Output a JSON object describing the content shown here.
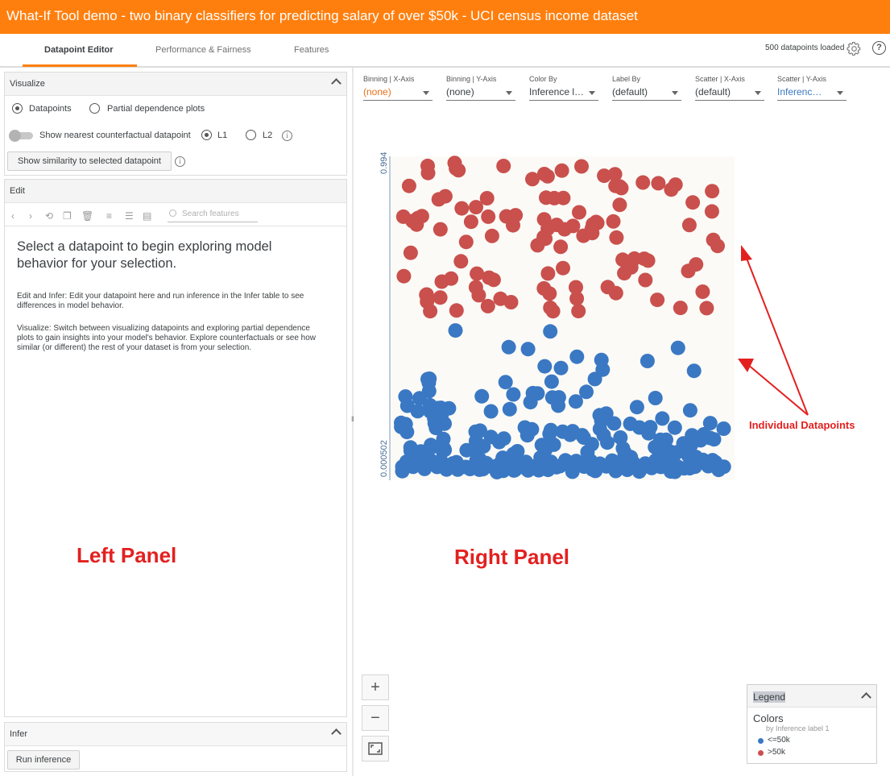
{
  "title": "What-If Tool demo - two binary classifiers for predicting salary of over $50k - UCI census income dataset",
  "tabs": {
    "datapoint_editor": "Datapoint Editor",
    "performance": "Performance & Fairness",
    "features": "Features"
  },
  "header": {
    "loaded": "500 datapoints loaded",
    "help": "?"
  },
  "visualize": {
    "title": "Visualize",
    "datapoints": "Datapoints",
    "pdp": "Partial dependence plots",
    "counterfactual": "Show nearest counterfactual datapoint",
    "l1": "L1",
    "l2": "L2",
    "similarity_button": "Show similarity to selected datapoint",
    "info": "i"
  },
  "edit": {
    "title": "Edit",
    "search_placeholder": "Search features",
    "heading": "Select a datapoint to begin exploring model behavior for your selection.",
    "para1": "Edit and Infer: Edit your datapoint here and run inference in the Infer table to see differences in model behavior.",
    "para2": "Visualize: Switch between visualizing datapoints and exploring partial dependence plots to gain insights into your model's behavior. Explore counterfactuals or see how similar (or different) the rest of your dataset is from your selection."
  },
  "infer": {
    "title": "Infer",
    "run_button": "Run inference"
  },
  "controls": {
    "binning_x": {
      "label": "Binning | X-Axis",
      "value": "(none)"
    },
    "binning_y": {
      "label": "Binning | Y-Axis",
      "value": "(none)"
    },
    "color_by": {
      "label": "Color By",
      "value": "Inference label"
    },
    "label_by": {
      "label": "Label By",
      "value": "(default)"
    },
    "scatter_x": {
      "label": "Scatter | X-Axis",
      "value": "(default)"
    },
    "scatter_y": {
      "label": "Scatter | Y-Axis",
      "value": "Inference score"
    }
  },
  "colors": {
    "accent": "#ff7f0e",
    "low": "#3a78c3",
    "high": "#c9504d"
  },
  "chart_data": {
    "type": "scatter",
    "ylim": [
      0.000502,
      0.994
    ],
    "ytick_labels": [
      "0.994",
      "0.000502"
    ],
    "series": [
      {
        "name": "<=50k",
        "color": "#3a78c3"
      },
      {
        "name": ">50k",
        "color": "#c9504d"
      }
    ]
  },
  "zoom": {
    "in": "+",
    "out": "−"
  },
  "legend": {
    "title": "Legend",
    "colors_heading": "Colors",
    "colors_sub": "by Inference label 1",
    "items": [
      "<=50k",
      ">50k"
    ]
  },
  "annotations": {
    "datapoints": "Individual Datapoints",
    "left": "Left Panel",
    "right": "Right Panel"
  }
}
